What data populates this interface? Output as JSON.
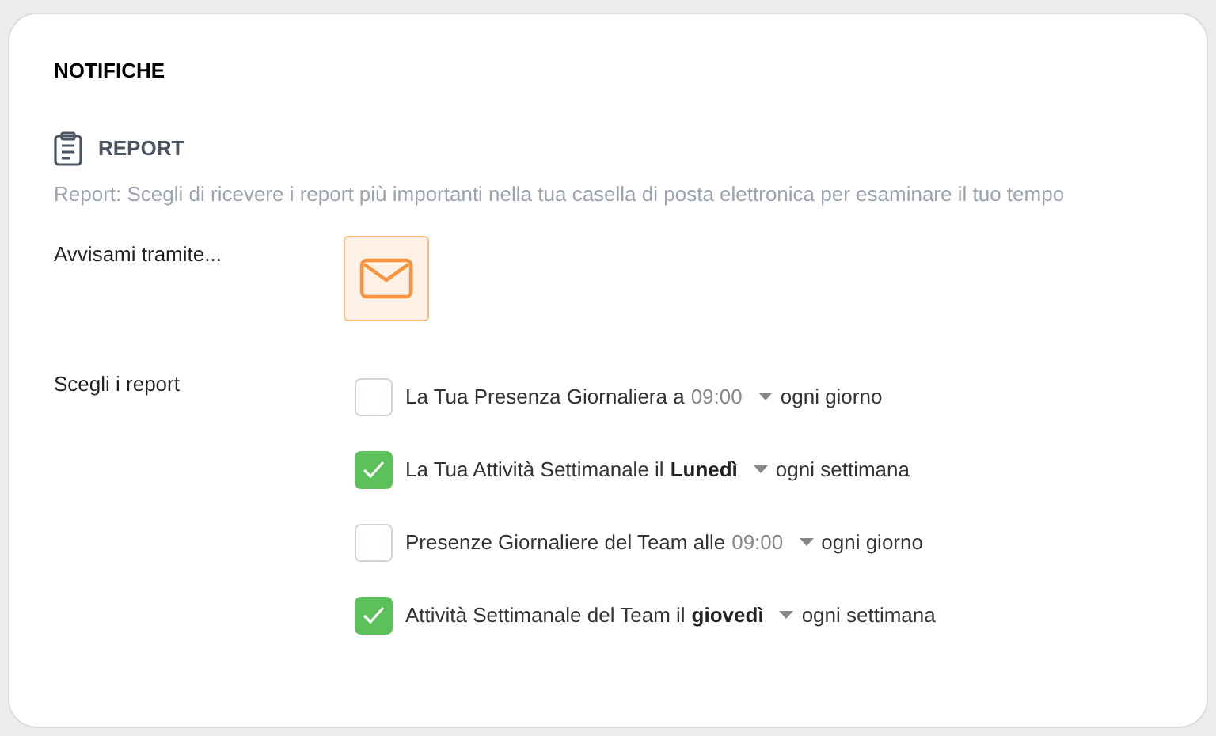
{
  "title": "NOTIFICHE",
  "section": {
    "heading": "REPORT",
    "description": "Report: Scegli di ricevere i report più importanti nella tua casella di posta elettronica per esaminare il tuo tempo"
  },
  "notify_via": {
    "label": "Avvisami tramite...",
    "channels": [
      {
        "kind": "email",
        "selected": true
      }
    ]
  },
  "reports": {
    "label": "Scegli i report",
    "items": [
      {
        "text": "La Tua Presenza Giornaliera a",
        "value": "09:00",
        "frequency": "ogni giorno",
        "checked": false
      },
      {
        "text": "La Tua Attività Settimanale il",
        "value": "Lunedì",
        "frequency": "ogni settimana",
        "checked": true
      },
      {
        "text": "Presenze Giornaliere del Team alle",
        "value": "09:00",
        "frequency": "ogni giorno",
        "checked": false
      },
      {
        "text": "Attività Settimanale del Team il",
        "value": "giovedì",
        "frequency": "ogni settimana",
        "checked": true
      }
    ]
  }
}
